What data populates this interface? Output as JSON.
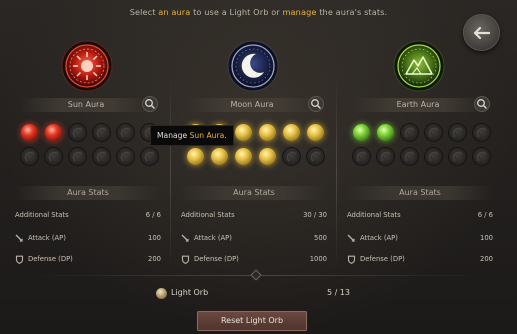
{
  "header": {
    "hint_prefix": "Select ",
    "hint_an_aura": "an aura",
    "hint_mid": " to use a Light Orb or ",
    "hint_manage": "manage",
    "hint_suffix": " the aura's stats."
  },
  "back_button": {
    "icon": "arrow-left-icon"
  },
  "tooltip": {
    "prefix": "Manage ",
    "highlight": "Sun Aura",
    "suffix": "."
  },
  "panels": [
    {
      "name": "Sun Aura",
      "emblem": "sun-emblem-icon",
      "accent": "#e23a25",
      "orbs": {
        "lit": 2,
        "total": 12,
        "color": "red"
      },
      "section_title": "Aura Stats",
      "stats": [
        {
          "label": "Additional Stats",
          "value": "6 / 6"
        },
        {
          "label": "Attack (AP)",
          "value": "100",
          "icon": "sword-icon"
        },
        {
          "label": "Defense (DP)",
          "value": "200",
          "icon": "shield-icon"
        }
      ]
    },
    {
      "name": "Moon Aura",
      "emblem": "moon-emblem-icon",
      "accent": "#e8c44a",
      "orbs": {
        "lit": 10,
        "total": 12,
        "color": "gold"
      },
      "section_title": "Aura Stats",
      "stats": [
        {
          "label": "Additional Stats",
          "value": "30 / 30"
        },
        {
          "label": "Attack (AP)",
          "value": "500",
          "icon": "sword-icon"
        },
        {
          "label": "Defense (DP)",
          "value": "1000",
          "icon": "shield-icon"
        }
      ]
    },
    {
      "name": "Earth Aura",
      "emblem": "earth-emblem-icon",
      "accent": "#7ed23a",
      "orbs": {
        "lit": 2,
        "total": 12,
        "color": "green"
      },
      "section_title": "Aura Stats",
      "stats": [
        {
          "label": "Additional Stats",
          "value": "6 / 6"
        },
        {
          "label": "Attack (AP)",
          "value": "100",
          "icon": "sword-icon"
        },
        {
          "label": "Defense (DP)",
          "value": "200",
          "icon": "shield-icon"
        }
      ]
    }
  ],
  "light_orb": {
    "label": "Light Orb",
    "count": "5 / 13",
    "icon": "light-orb-icon"
  },
  "reset_button": {
    "label": "Reset Light Orb"
  }
}
